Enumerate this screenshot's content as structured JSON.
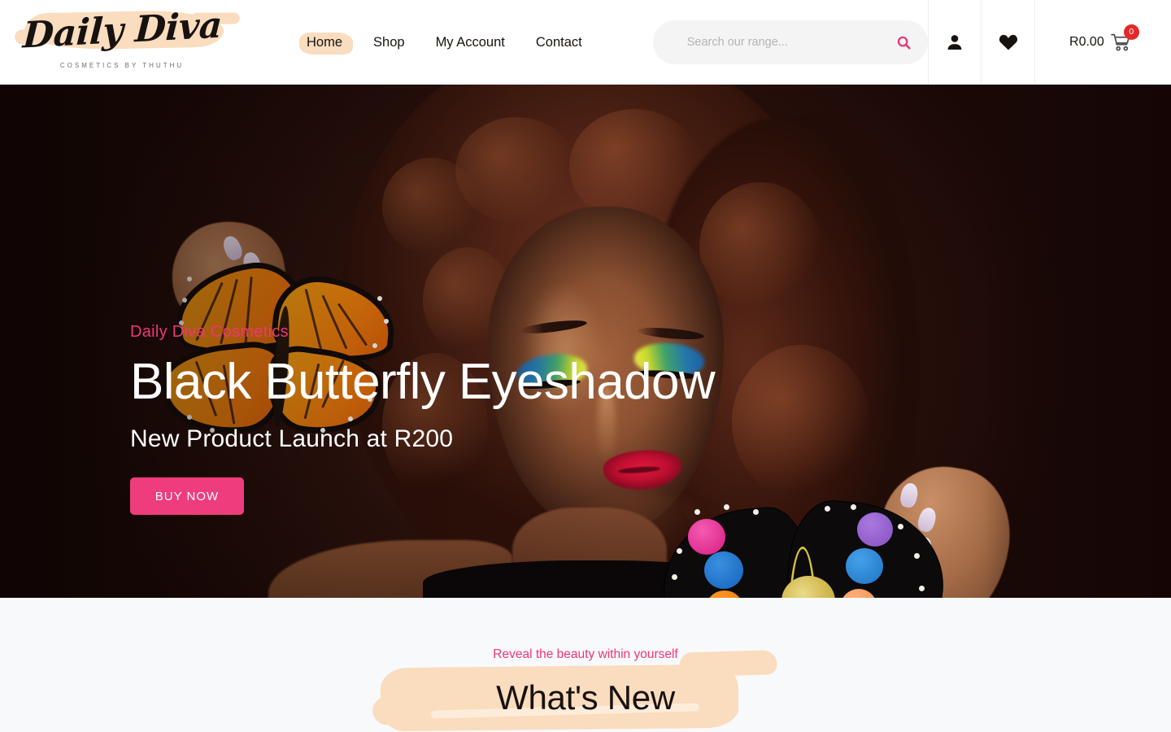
{
  "header": {
    "logo": {
      "word": "Daily Diva",
      "tagline": "COSMETICS BY THUTHU"
    },
    "nav": [
      {
        "label": "Home",
        "active": true
      },
      {
        "label": "Shop",
        "active": false
      },
      {
        "label": "My Account",
        "active": false
      },
      {
        "label": "Contact",
        "active": false
      }
    ],
    "search": {
      "placeholder": "Search our range...",
      "value": "",
      "icon": "search-icon",
      "icon_color": "#e8336d"
    },
    "account": {
      "icon": "user-icon"
    },
    "wishlist": {
      "icon": "heart-icon"
    },
    "cart": {
      "amount": "R0.00",
      "count": "0",
      "icon": "shopping-cart-icon",
      "badge_color": "#e32828"
    }
  },
  "hero": {
    "eyebrow": "Daily Diva Cosmetics",
    "title": "Black Butterfly Eyeshadow",
    "subtitle": "New Product Launch at R200",
    "cta_label": "BUY NOW",
    "cta_color": "#ef3c7d",
    "eyebrow_color": "#ee3777",
    "background_alt": "Model with blue and yellow butterfly-wing eyeshadow holding an orange monarch butterfly and a black butterfly-shaped eyeshadow palette"
  },
  "whats_new": {
    "eyebrow": "Reveal the beauty within yourself",
    "title": "What's New",
    "brush_color": "#fadcbe",
    "eyebrow_color": "#ee3777"
  }
}
